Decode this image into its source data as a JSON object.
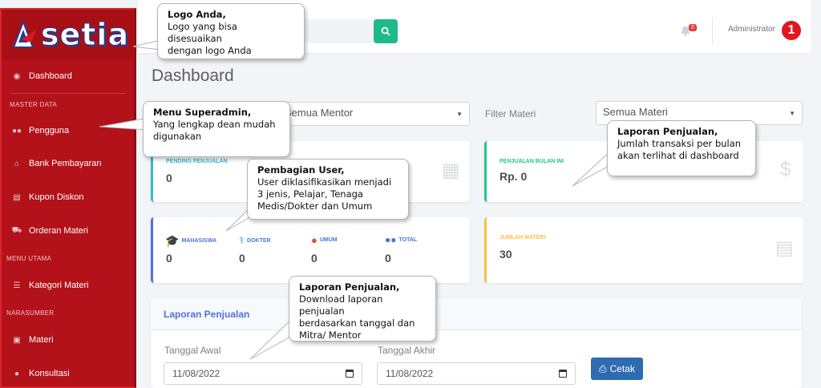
{
  "brand": {
    "logo_text": "setia",
    "colors": {
      "sidebar": "#b3121a",
      "primary": "#4e73df",
      "success": "#1fb98a",
      "danger": "#e2161d",
      "warning": "#f6c23e",
      "info": "#36b9cc"
    }
  },
  "sidebar": {
    "items": [
      {
        "id": "dashboard",
        "label": "Dashboard",
        "icon": "dashboard-icon"
      },
      {
        "id": "pengguna",
        "label": "Pengguna",
        "icon": "users-icon"
      },
      {
        "id": "bank",
        "label": "Bank Pembayaran",
        "icon": "bank-icon"
      },
      {
        "id": "kupon",
        "label": "Kupon Diskon",
        "icon": "document-icon"
      },
      {
        "id": "orderan",
        "label": "Orderan Materi",
        "icon": "cart-icon"
      },
      {
        "id": "kategori",
        "label": "Kategori Materi",
        "icon": "list-icon"
      },
      {
        "id": "materi",
        "label": "Materi",
        "icon": "book-icon"
      },
      {
        "id": "konsultasi",
        "label": "Konsultasi",
        "icon": "chat-icon"
      }
    ],
    "headings": {
      "master": "MASTER DATA",
      "menu": "MENU UTAMA",
      "narasumber": "NARASUMBER"
    }
  },
  "topbar": {
    "notification_count": "0",
    "user": "Administrator",
    "step_number": "1"
  },
  "page": {
    "title": "Dashboard"
  },
  "filters": {
    "mentor_value": "Semua Mentor",
    "materi_label": "Filter Materi",
    "materi_value": "Semua Materi"
  },
  "cards": {
    "pending": {
      "label": "PENDING PENJUALAN",
      "value": "0"
    },
    "bulan_ini": {
      "label": "PENJUALAN BULAN INI",
      "value": "Rp. 0"
    },
    "users": [
      {
        "label": "MAHASISWA",
        "value": "0"
      },
      {
        "label": "DOKTER",
        "value": "0"
      },
      {
        "label": "UMUM",
        "value": "0"
      },
      {
        "label": "TOTAL",
        "value": "0"
      }
    ],
    "jumlah_materi": {
      "label": "JUMLAH MATERI",
      "value": "30"
    }
  },
  "report": {
    "title": "Laporan Penjualan",
    "start_label": "Tanggal Awal",
    "start_value": "11/08/2022",
    "end_label": "Tanggal Akhir",
    "end_value": "11/08/2022",
    "print_label": "Cetak"
  },
  "callouts": {
    "logo": {
      "title": "Logo Anda,",
      "line1": "Logo yang bisa disesuaikan",
      "line2": "dengan logo Anda"
    },
    "menu": {
      "title": "Menu Superadmin,",
      "line1": "Yang lengkap dean mudah",
      "line2": "digunakan"
    },
    "users": {
      "title": "Pembagian User,",
      "line1": "User diklasifikasikan menjadi",
      "line2": "3 jenis, Pelajar, Tenaga",
      "line3": "Medis/Dokter dan Umum"
    },
    "sales": {
      "title": "Laporan Penjualan,",
      "line1": "Jumlah transaksi per bulan",
      "line2": "akan terlihat di dashboard"
    },
    "report": {
      "title": "Laporan Penjualan,",
      "line1": "Download laporan penjualan",
      "line2": "berdasarkan tanggal dan",
      "line3": "Mitra/ Mentor"
    }
  }
}
